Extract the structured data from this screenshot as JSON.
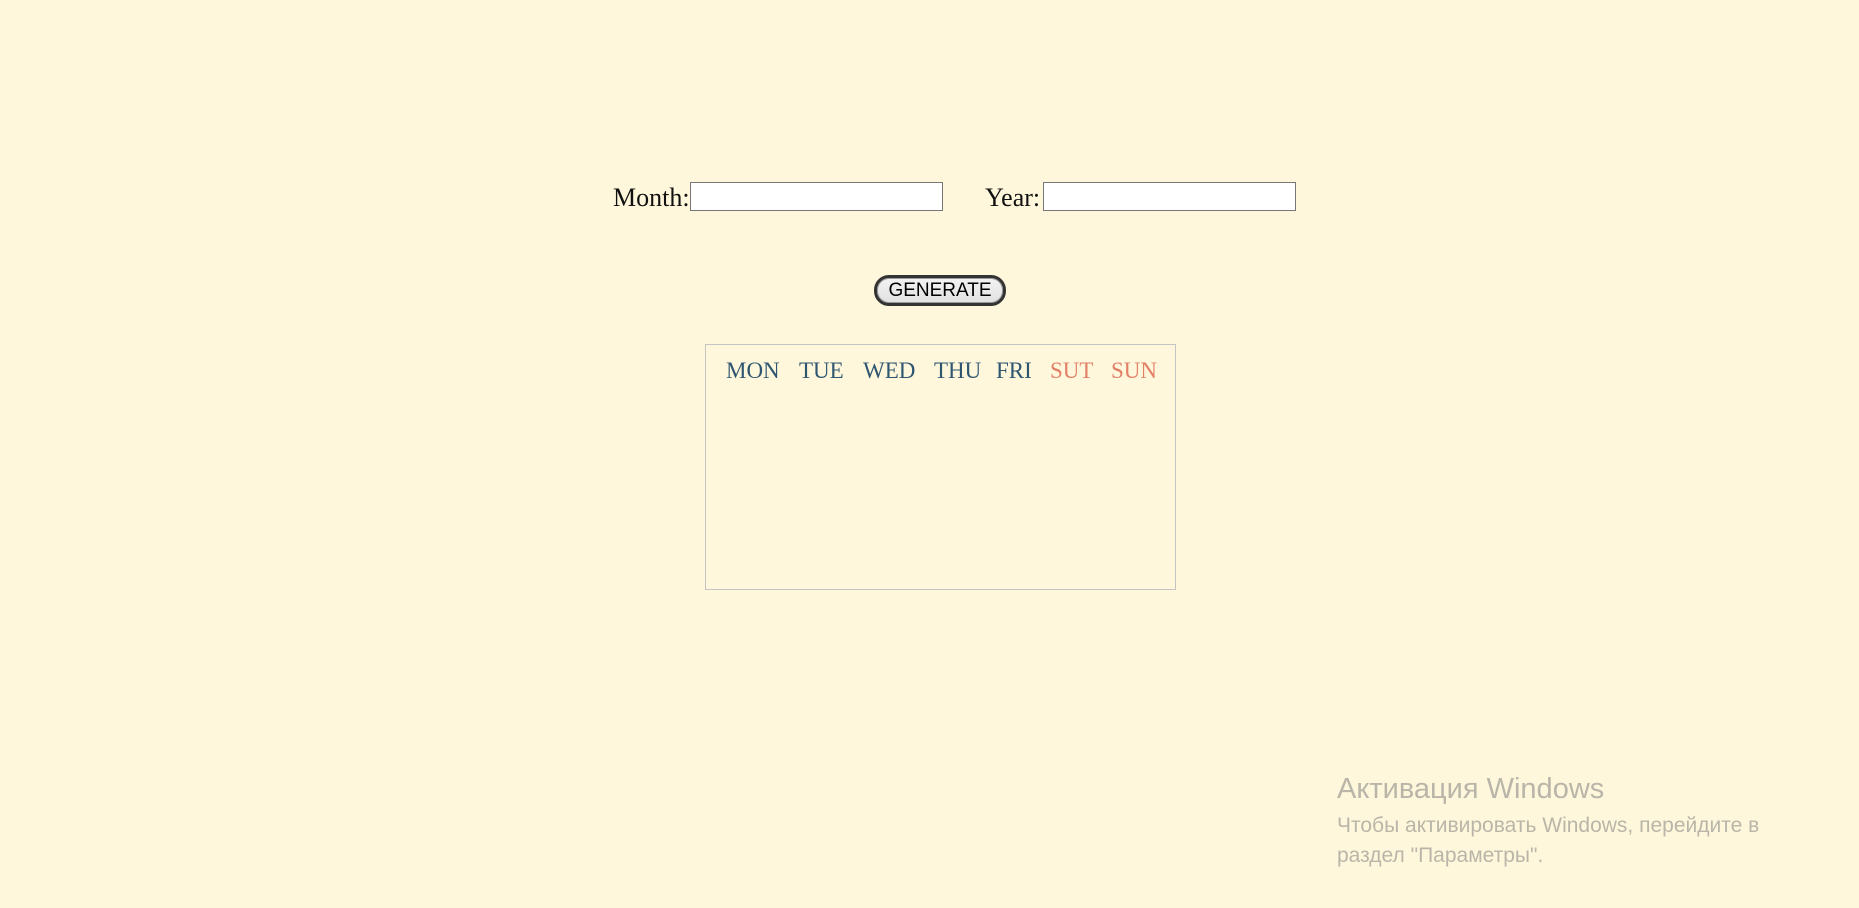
{
  "form": {
    "month_label": "Month:",
    "month_value": "",
    "year_label": "Year:",
    "year_value": ""
  },
  "generate_button_label": "GENERATE",
  "calendar": {
    "days": [
      {
        "label": "MON",
        "color": "#2e5671"
      },
      {
        "label": "TUE",
        "color": "#2e5671"
      },
      {
        "label": "WED",
        "color": "#2e5671"
      },
      {
        "label": "THU",
        "color": "#2e5671"
      },
      {
        "label": "FRI",
        "color": "#2e5671"
      },
      {
        "label": "SUT",
        "color": "#e27f67"
      },
      {
        "label": "SUN",
        "color": "#e27f67"
      }
    ]
  },
  "watermark": {
    "title": "Активация Windows",
    "line1": "Чтобы активировать Windows, перейдите в",
    "line2": "раздел \"Параметры\"."
  },
  "colors": {
    "background": "#fff7db",
    "weekday": "#2e5671",
    "weekend": "#e27f67",
    "watermark": "#b9b6a9"
  }
}
